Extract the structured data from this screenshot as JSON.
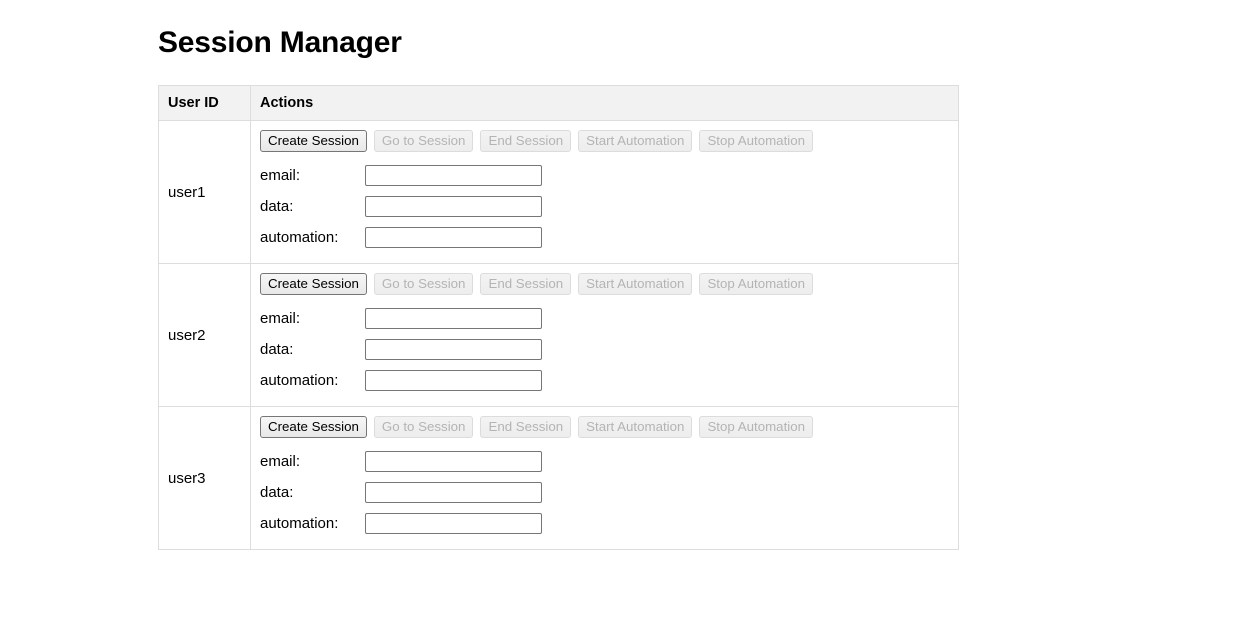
{
  "page": {
    "title": "Session Manager"
  },
  "table": {
    "columns": [
      "User ID",
      "Actions"
    ],
    "buttons": [
      {
        "label": "Create Session",
        "name": "create-session-button",
        "disabled": false
      },
      {
        "label": "Go to Session",
        "name": "go-to-session-button",
        "disabled": true
      },
      {
        "label": "End Session",
        "name": "end-session-button",
        "disabled": true
      },
      {
        "label": "Start Automation",
        "name": "start-automation-button",
        "disabled": true
      },
      {
        "label": "Stop Automation",
        "name": "stop-automation-button",
        "disabled": true
      }
    ],
    "fields": [
      {
        "label": "email:",
        "name": "email-field",
        "value": "",
        "placeholder": ""
      },
      {
        "label": "data:",
        "name": "data-field",
        "value": "",
        "placeholder": ""
      },
      {
        "label": "automation:",
        "name": "automation-field",
        "value": "",
        "placeholder": ""
      }
    ],
    "rows": [
      {
        "user_id": "user1"
      },
      {
        "user_id": "user2"
      },
      {
        "user_id": "user3"
      }
    ]
  },
  "colors": {
    "header_bg": "#f2f2f2",
    "border": "#dddddd",
    "button_border": "#767676",
    "button_disabled_text": "#b4b4b4",
    "page_bg": "#ffffff",
    "text": "#000000"
  }
}
